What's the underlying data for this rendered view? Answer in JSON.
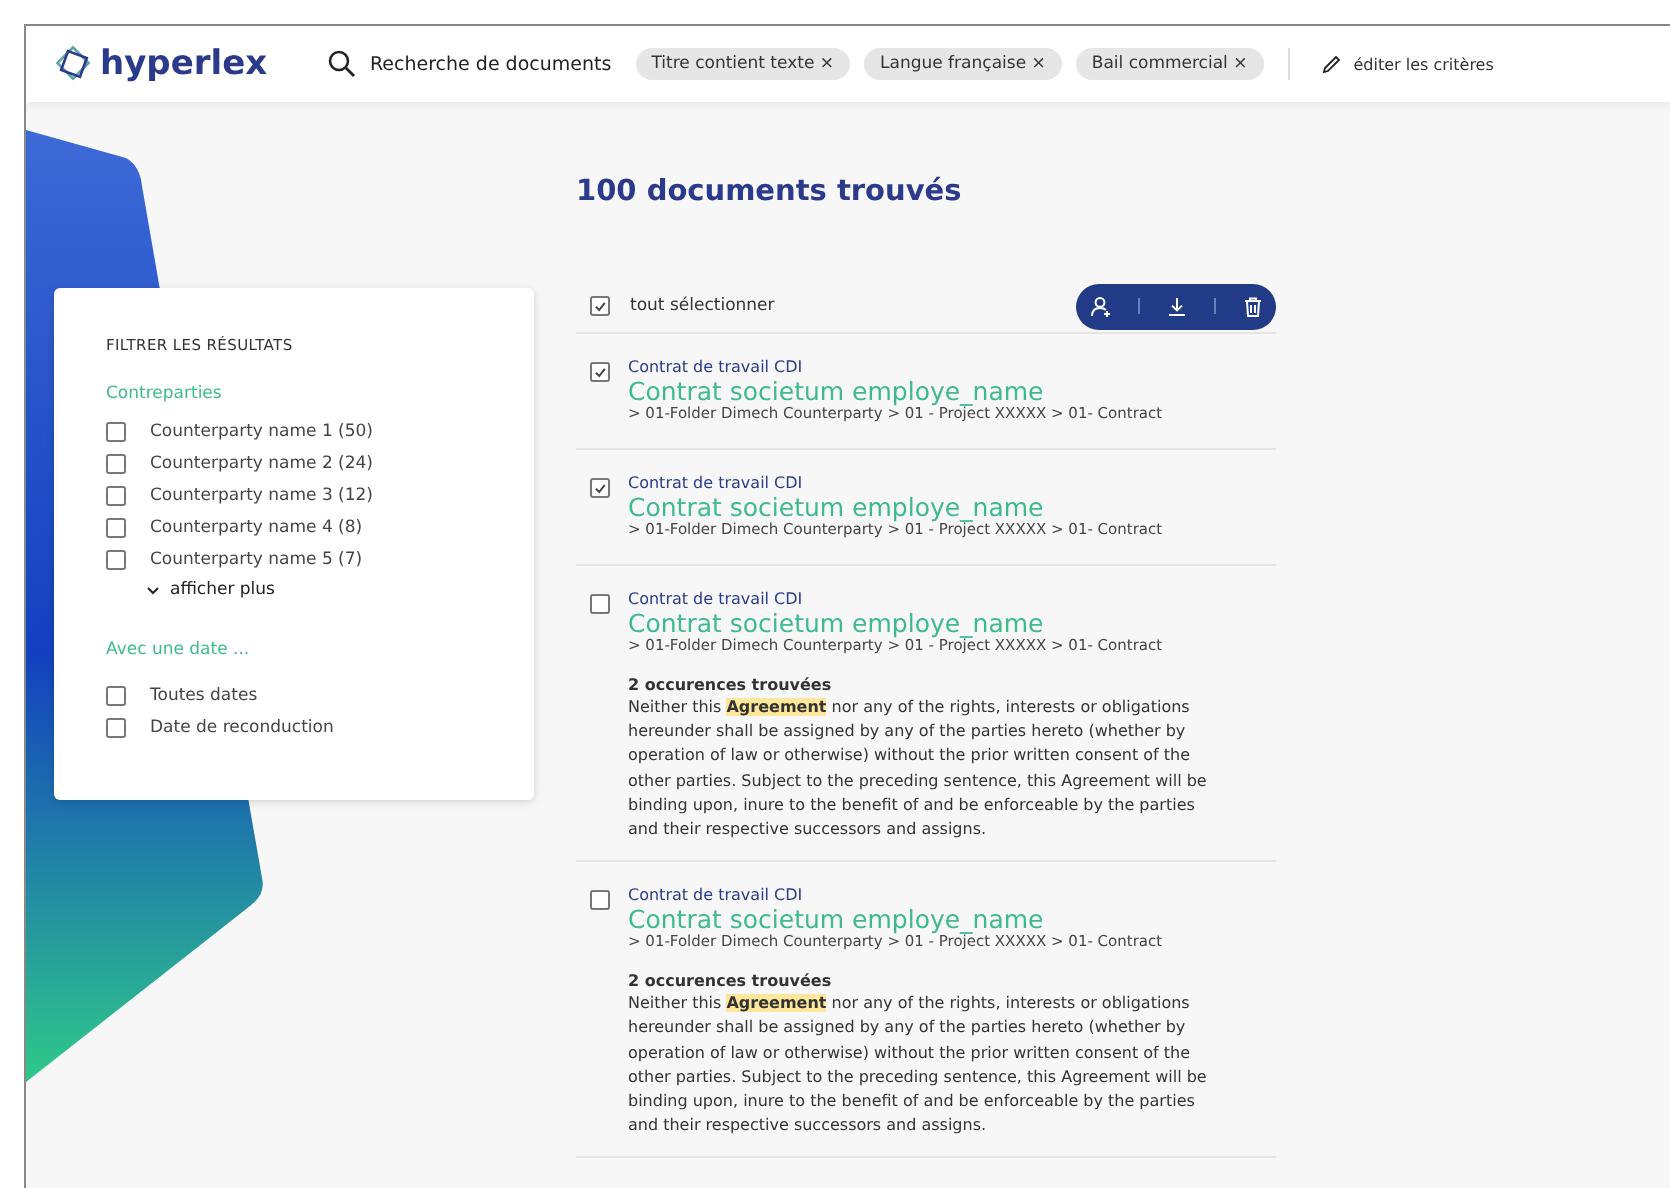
{
  "header": {
    "logo": "hyperlex",
    "search_label": "Recherche de documents",
    "chips": [
      {
        "label": "Titre contient texte",
        "remove": "×"
      },
      {
        "label": "Langue française",
        "remove": "×"
      },
      {
        "label": "Bail commercial",
        "remove": "×"
      }
    ],
    "edit_label": "éditer les critères"
  },
  "filter": {
    "title": "FILTRER LES RÉSULTATS",
    "sections": [
      {
        "title": "Contreparties",
        "options": [
          {
            "label": "Counterparty name 1 (50)",
            "checked": false
          },
          {
            "label": "Counterparty name 2 (24)",
            "checked": false
          },
          {
            "label": "Counterparty name 3 (12)",
            "checked": false
          },
          {
            "label": "Counterparty name 4 (8)",
            "checked": false
          },
          {
            "label": "Counterparty name 5 (7)",
            "checked": false
          }
        ],
        "more": "afficher plus"
      },
      {
        "title": "Avec une date ...",
        "options": [
          {
            "label": "Toutes dates",
            "checked": false
          },
          {
            "label": "Date de reconduction",
            "checked": false
          }
        ]
      }
    ]
  },
  "results": {
    "heading": "100 documents trouvés",
    "select_all": {
      "label": "tout sélectionner",
      "checked": true
    },
    "documents": [
      {
        "type": "Contrat de travail CDI",
        "title": "Contrat societum employe_name",
        "path": "> 01-Folder Dimech Counterparty > 01 - Project XXXXX > 01- Contract",
        "checked": true
      },
      {
        "type": "Contrat de travail CDI",
        "title": "Contrat societum employe_name",
        "path": "> 01-Folder Dimech Counterparty > 01 - Project XXXXX > 01- Contract",
        "checked": true
      },
      {
        "type": "Contrat de travail CDI",
        "title": "Contrat societum employe_name",
        "path": "> 01-Folder Dimech Counterparty > 01 - Project XXXXX > 01- Contract",
        "checked": false,
        "occurrences": "2 occurences trouvées",
        "excerpt": "Neither this **Agreement** nor any of the rights, interests or obligations hereunder shall be assigned by any of the parties hereto (whether by operation of law or otherwise) without the prior written consent of the other parties. Subject to the preceding sentence, this Agreement will be binding upon, inure to the benefit of and be enforceable by the parties and their respective successors and assigns."
      },
      {
        "type": "Contrat de travail CDI",
        "title": "Contrat societum employe_name",
        "path": "> 01-Folder Dimech Counterparty > 01 - Project XXXXX > 01- Contract",
        "checked": false,
        "occurrences": "2 occurences trouvées",
        "excerpt": "Neither this **Agreement** nor any of the rights, interests or obligations hereunder shall be assigned by any of the parties hereto (whether by operation of law or otherwise) without the prior written consent of the other parties. Subject to the preceding sentence, this Agreement will be binding upon, inure to the benefit of and be enforceable by the parties and their respective successors and assigns."
      }
    ]
  }
}
